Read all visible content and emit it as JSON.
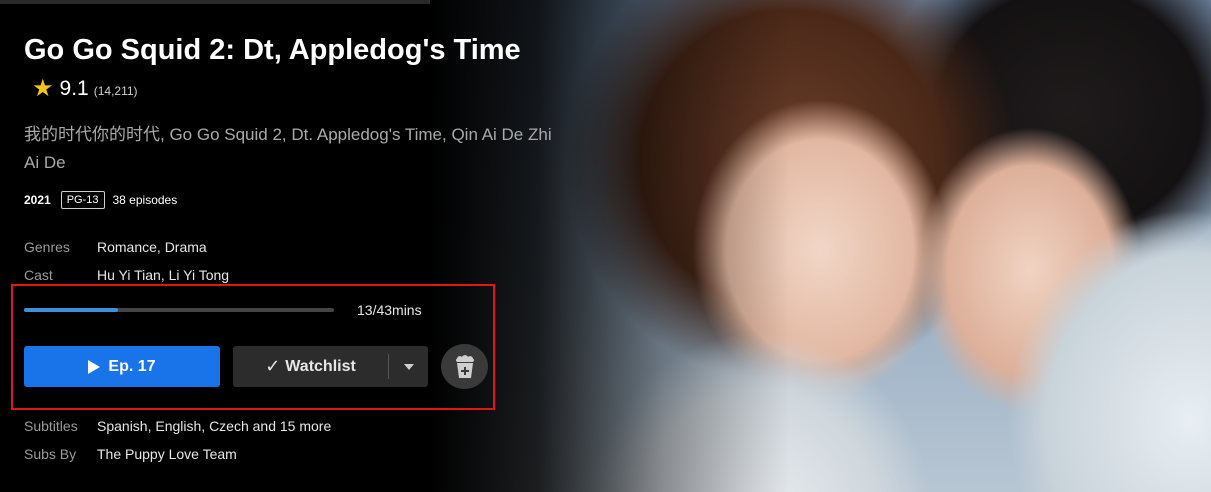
{
  "show": {
    "title": "Go Go Squid 2: Dt, Appledog's Time",
    "rating": "9.1",
    "rating_count": "(14,211)",
    "alt_titles": "我的时代你的时代, Go Go Squid 2, Dt. Appledog's Time, Qin Ai De Zhi Ai De",
    "year": "2021",
    "content_rating": "PG-13",
    "episodes": "38 episodes"
  },
  "details": {
    "genres_label": "Genres",
    "genres_value": "Romance, Drama",
    "cast_label": "Cast",
    "cast_value": "Hu Yi Tian, Li Yi Tong"
  },
  "progress": {
    "text": "13/43mins",
    "fraction": 0.302
  },
  "actions": {
    "play_label": "Ep. 17",
    "watchlist_label": "Watchlist"
  },
  "subtitles": {
    "subtitles_label": "Subtitles",
    "subtitles_value": "Spanish, English, Czech and 15 more",
    "subs_by_label": "Subs By",
    "subs_by_value": "The Puppy Love Team"
  },
  "icons": {
    "star": "star-icon",
    "play": "play-icon",
    "check": "check-icon",
    "dropdown": "chevron-down-icon",
    "popcorn": "popcorn-add-icon"
  },
  "colors": {
    "accent": "#1874e8",
    "progress": "#3d8fd8",
    "star": "#f5c518",
    "highlight": "#e0161b"
  }
}
